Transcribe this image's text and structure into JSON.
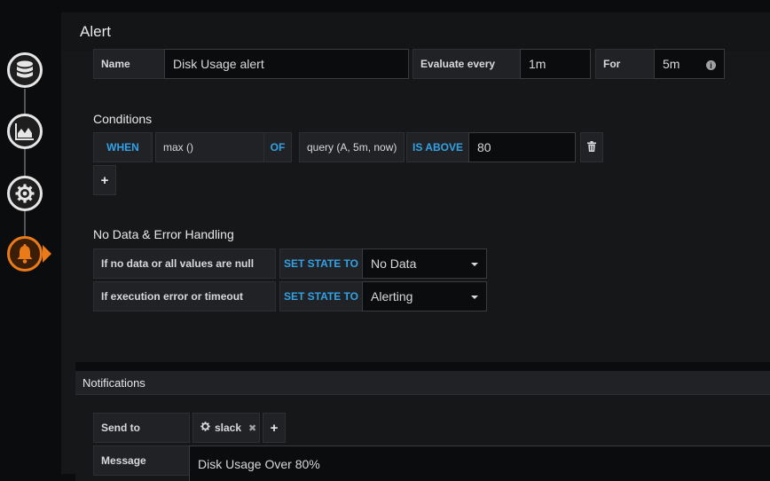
{
  "panel": {
    "title": "Alert"
  },
  "sidebar": {
    "items": [
      {
        "name": "Queries",
        "icon": "database-icon"
      },
      {
        "name": "Visualization",
        "icon": "chart-area-icon"
      },
      {
        "name": "General",
        "icon": "gear-icon"
      },
      {
        "name": "Alert",
        "icon": "bell-icon",
        "active": true
      }
    ],
    "active_color": "#eb7b18"
  },
  "rule": {
    "name_label": "Name",
    "name_value": "Disk Usage alert",
    "evaluate_label": "Evaluate every",
    "evaluate_value": "1m",
    "for_label": "For",
    "for_value": "5m"
  },
  "conditions": {
    "title": "Conditions",
    "when": "WHEN",
    "reducer": "max ()",
    "of": "OF",
    "query": "query (A, 5m, now)",
    "evaluator": "IS ABOVE",
    "threshold": "80",
    "add_label": "+"
  },
  "no_data": {
    "title": "No Data & Error Handling",
    "rows": [
      {
        "label": "If no data or all values are null",
        "set_state": "SET STATE TO",
        "value": "No Data"
      },
      {
        "label": "If execution error or timeout",
        "set_state": "SET STATE TO",
        "value": "Alerting"
      }
    ]
  },
  "notifications": {
    "title": "Notifications",
    "send_to_label": "Send to",
    "channels": [
      {
        "name": "slack",
        "icon": "gear-icon"
      }
    ],
    "add_label": "+",
    "message_label": "Message",
    "message_value": "Disk Usage Over 80%"
  },
  "colors": {
    "accent_blue": "#33a2e5",
    "panel_bg": "#161719",
    "page_bg": "#0b0c0e"
  }
}
